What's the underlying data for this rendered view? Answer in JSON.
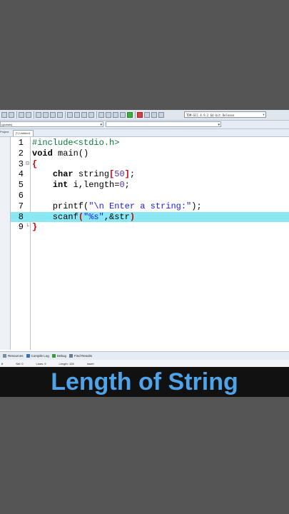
{
  "toolbar": {
    "compiler": "TDM-GCC 4.9.2 64-bit Release"
  },
  "toolbar2": {
    "left_combo": "(globals)",
    "right_combo": ""
  },
  "tabs": {
    "left_tab": "Project",
    "file_tab": "[*] Untitled1"
  },
  "editor": {
    "lines": [
      {
        "n": "1",
        "fold": "",
        "parts": [
          [
            "pp",
            "#include<stdio.h>"
          ]
        ]
      },
      {
        "n": "2",
        "fold": "",
        "parts": [
          [
            "kw",
            "void"
          ],
          [
            "normal",
            " main()"
          ]
        ]
      },
      {
        "n": "3",
        "fold": "⊟",
        "parts": [
          [
            "red",
            "{"
          ]
        ]
      },
      {
        "n": "4",
        "fold": "",
        "parts": [
          [
            "normal",
            "    "
          ],
          [
            "kw",
            "char"
          ],
          [
            "normal",
            " string"
          ],
          [
            "red",
            "["
          ],
          [
            "num",
            "50"
          ],
          [
            "red",
            "]"
          ],
          [
            "normal",
            ";"
          ]
        ]
      },
      {
        "n": "5",
        "fold": "",
        "parts": [
          [
            "normal",
            "    "
          ],
          [
            "kw",
            "int"
          ],
          [
            "normal",
            " i,length="
          ],
          [
            "num",
            "0"
          ],
          [
            "normal",
            ";"
          ]
        ]
      },
      {
        "n": "6",
        "fold": "",
        "parts": []
      },
      {
        "n": "7",
        "fold": "",
        "parts": [
          [
            "normal",
            "    printf("
          ],
          [
            "str",
            "\"\\n Enter a string:\""
          ],
          [
            "normal",
            ");"
          ]
        ]
      },
      {
        "n": "8",
        "fold": "",
        "highlight": true,
        "parts": [
          [
            "normal",
            "    scanf"
          ],
          [
            "bracket",
            "("
          ],
          [
            "str",
            "\"%s\""
          ],
          [
            "normal",
            ",&str"
          ],
          [
            "bracket",
            ")"
          ]
        ]
      },
      {
        "n": "9",
        "fold": "└",
        "parts": [
          [
            "red",
            "}"
          ]
        ]
      }
    ]
  },
  "bottom_tabs": [
    {
      "label": "Resources",
      "icon": "resources-icon",
      "color": "#7a8aa0"
    },
    {
      "label": "Compile Log",
      "icon": "compile-log-icon",
      "color": "#3b6fb6"
    },
    {
      "label": "Debug",
      "icon": "debug-icon",
      "color": "#3a9a3a"
    },
    {
      "label": "Find Results",
      "icon": "find-results-icon",
      "color": "#6a7a90"
    }
  ],
  "status": {
    "line": "8",
    "col": "Col: 20",
    "sel": "Sel: 0",
    "lines": "Lines: 9",
    "length": "Length: 128",
    "mode": "Insert"
  },
  "banner": {
    "title": "Length of String"
  }
}
